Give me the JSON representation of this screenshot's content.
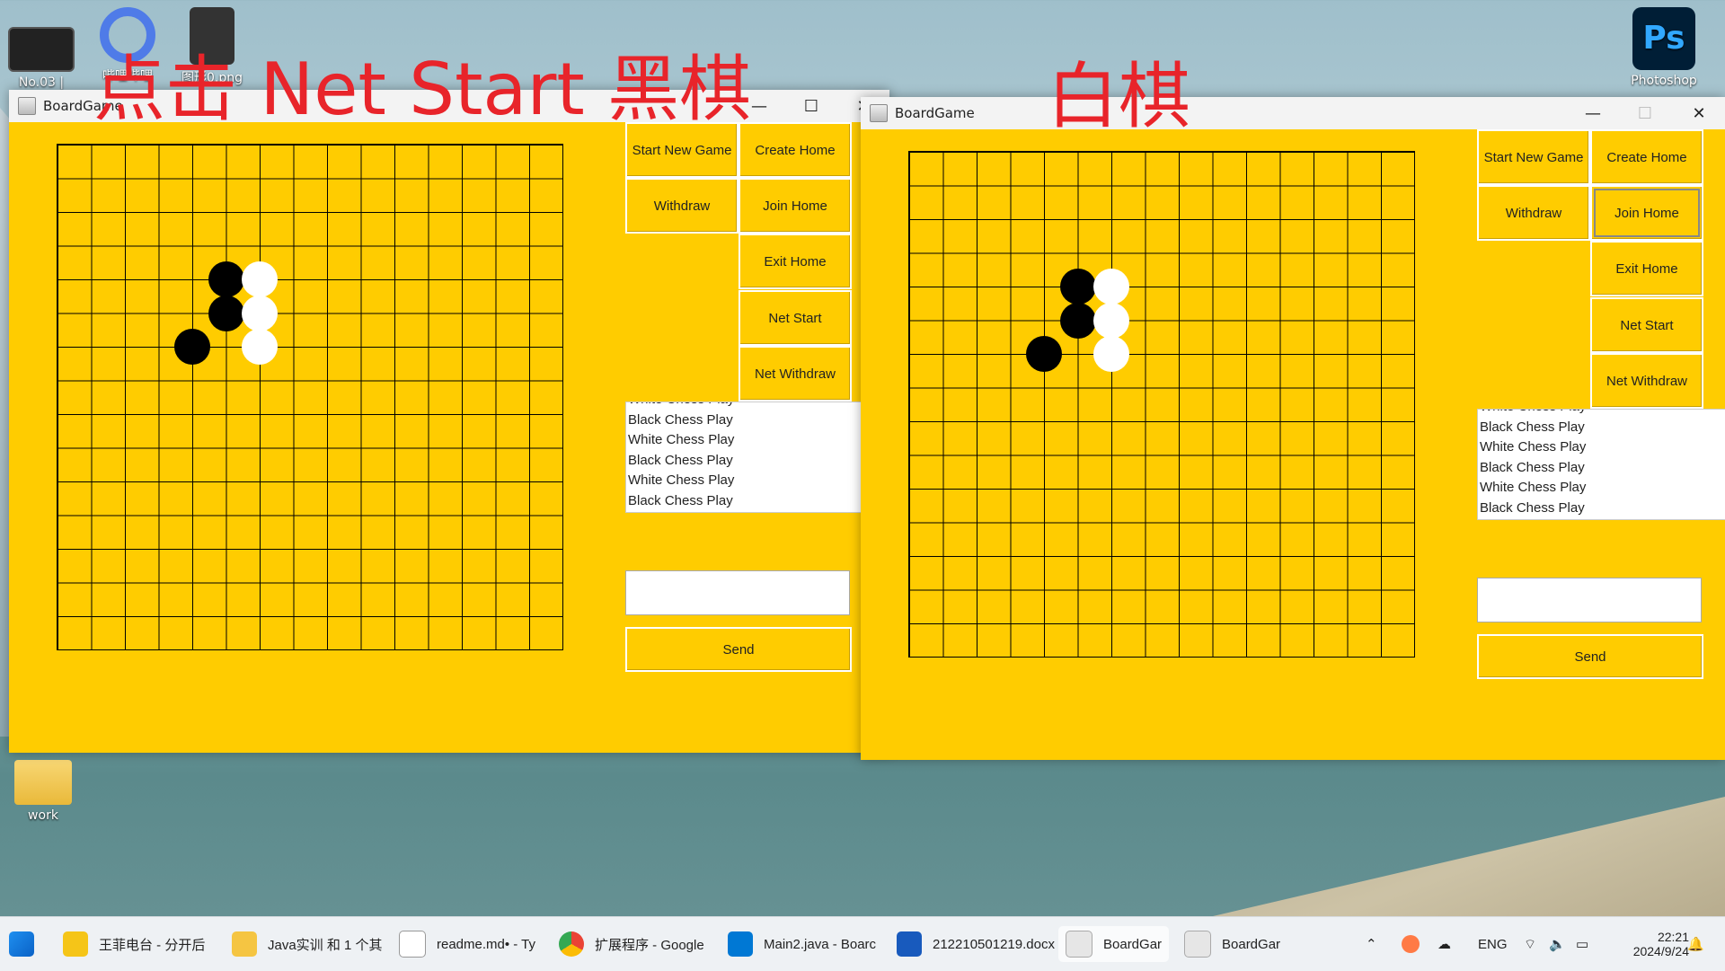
{
  "desktop": {
    "icons": [
      {
        "label": "No.03 | 摸... ",
        "color": "#222"
      },
      {
        "label": "哔哩哔哩",
        "color": "#3a7bd5"
      },
      {
        "label": "图形0.png",
        "color": "#444"
      },
      {
        "label": "Photoshop",
        "color": "#001e36"
      },
      {
        "label": "work",
        "color": "#f5c542"
      }
    ],
    "overlay_left": "点击 Net Start 黑棋",
    "overlay_right": "白棋"
  },
  "window_left": {
    "title": "BoardGame",
    "buttons": {
      "start_new_game": "Start New Game",
      "create_home": "Create Home",
      "withdraw": "Withdraw",
      "join_home": "Join Home",
      "exit_home": "Exit Home",
      "net_start": "Net Start",
      "net_withdraw": "Net Withdraw",
      "send": "Send"
    },
    "log": [
      "White Chess Play",
      "Black Chess Play",
      "White Chess Play",
      "Black Chess Play",
      "White Chess Play",
      "Black Chess Play"
    ]
  },
  "window_right": {
    "title": "BoardGame",
    "buttons": {
      "start_new_game": "Start New Game",
      "create_home": "Create Home",
      "withdraw": "Withdraw",
      "join_home": "Join Home",
      "exit_home": "Exit Home",
      "net_start": "Net Start",
      "net_withdraw": "Net Withdraw",
      "send": "Send"
    },
    "log": [
      "White Chess Play",
      "Black Chess Play",
      "White Chess Play",
      "Black Chess Play",
      "White Chess Play",
      "Black Chess Play"
    ]
  },
  "board": {
    "size": 16,
    "stones": [
      {
        "col": 5,
        "row": 4,
        "color": "black"
      },
      {
        "col": 6,
        "row": 4,
        "color": "white"
      },
      {
        "col": 5,
        "row": 5,
        "color": "black"
      },
      {
        "col": 6,
        "row": 5,
        "color": "white"
      },
      {
        "col": 4,
        "row": 6,
        "color": "black"
      },
      {
        "col": 6,
        "row": 6,
        "color": "white"
      }
    ]
  },
  "taskbar": {
    "items": [
      {
        "label": "王菲电台 - 分开后",
        "icon": "player-icon",
        "color": "#f5c518"
      },
      {
        "label": "Java实训 和 1 个其",
        "icon": "folder-icon",
        "color": "#f5c542"
      },
      {
        "label": "readme.md• - Ty",
        "icon": "typora-icon",
        "color": "#ffffff"
      },
      {
        "label": "扩展程序 - Google",
        "icon": "chrome-icon",
        "color": "#4285f4"
      },
      {
        "label": "Main2.java - Boarc",
        "icon": "vscode-icon",
        "color": "#0078d4"
      },
      {
        "label": "212210501219.docx",
        "icon": "word-icon",
        "color": "#185abd"
      },
      {
        "label": "BoardGar",
        "icon": "java-icon",
        "color": "#e76f00"
      },
      {
        "label": "BoardGar",
        "icon": "java-icon",
        "color": "#e76f00"
      }
    ],
    "lang": "ENG",
    "time": "22:21",
    "date": "2024/9/24"
  }
}
